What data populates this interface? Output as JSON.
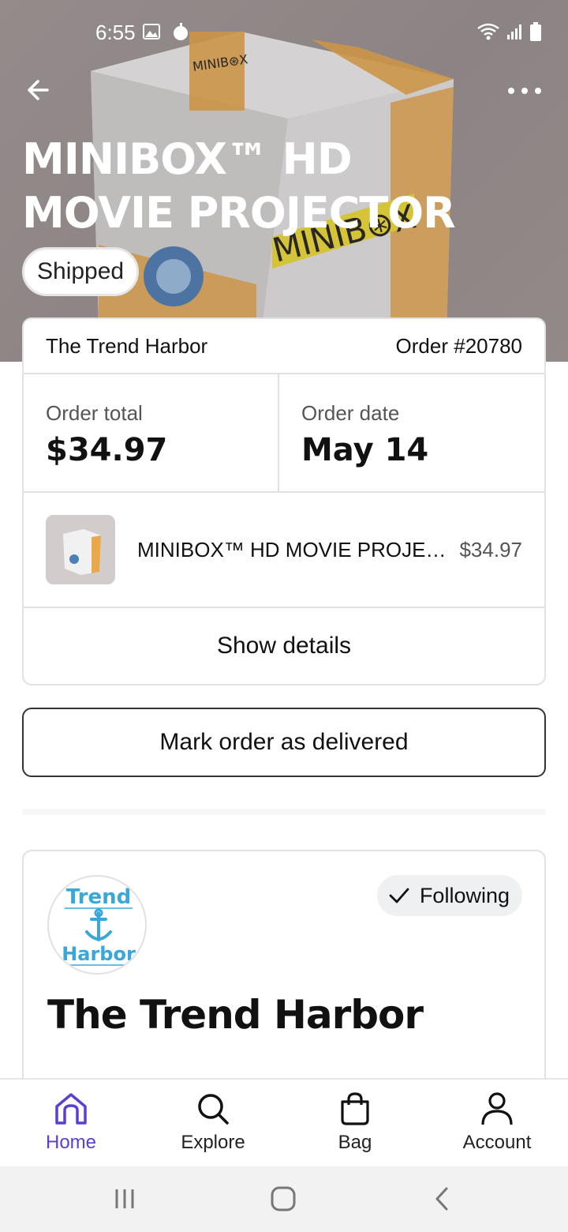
{
  "status_bar": {
    "time": "6:55"
  },
  "header": {
    "title": "MINIBOX™ HD MOVIE PROJECTOR",
    "status_badge": "Shipped"
  },
  "order": {
    "shop_name": "The Trend Harbor",
    "order_number": "Order #20780",
    "total_label": "Order total",
    "total_value": "$34.97",
    "date_label": "Order date",
    "date_value": "May 14",
    "item": {
      "name": "MINIBOX™ HD MOVIE PROJECTOR",
      "price": "$34.97"
    },
    "show_details": "Show details"
  },
  "mark_delivered": "Mark order as delivered",
  "shop": {
    "logo_text_top": "Trend",
    "logo_text_bottom": "Harbor",
    "following_label": "Following",
    "name": "The Trend Harbor"
  },
  "bottom_nav": {
    "items": [
      {
        "label": "Home",
        "icon": "home-icon",
        "active": true
      },
      {
        "label": "Explore",
        "icon": "search-icon",
        "active": false
      },
      {
        "label": "Bag",
        "icon": "bag-icon",
        "active": false
      },
      {
        "label": "Account",
        "icon": "account-icon",
        "active": false
      }
    ]
  },
  "colors": {
    "accent": "#5a3fd1",
    "logo_blue": "#3aa7d8"
  }
}
